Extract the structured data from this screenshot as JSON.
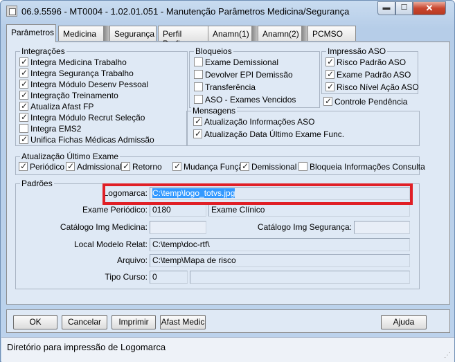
{
  "window": {
    "title": "06.9.5596 - MT0004 - 1.02.01.051 - Manutenção Parâmetros Medicina/Segurança",
    "min_glyph": "▬",
    "max_glyph": "☐",
    "close_glyph": "✕"
  },
  "tabs": [
    {
      "label": "Parâmetros",
      "active": true
    },
    {
      "label": "Medicina"
    },
    {
      "label": "Segurança"
    },
    {
      "label": "Perfil Profis"
    },
    {
      "label": "Anamn(1)"
    },
    {
      "label": "Anamn(2)"
    },
    {
      "label": "PCMSO"
    }
  ],
  "integracoes": {
    "title": "Integrações",
    "items": [
      {
        "label": "Integra Medicina Trabalho",
        "checked": true
      },
      {
        "label": "Integra Segurança Trabalho",
        "checked": true
      },
      {
        "label": "Integra Módulo Desenv Pessoal",
        "checked": true
      },
      {
        "label": "Integração Treinamento",
        "checked": true
      },
      {
        "label": "Atualiza Afast FP",
        "checked": true
      },
      {
        "label": "Integra Módulo Recrut Seleção",
        "checked": true
      },
      {
        "label": "Integra EMS2",
        "checked": false
      },
      {
        "label": "Unifica Fichas Médicas Admissão",
        "checked": true
      }
    ]
  },
  "bloqueios": {
    "title": "Bloqueios",
    "items": [
      {
        "label": "Exame Demissional",
        "checked": false
      },
      {
        "label": "Devolver EPI Demissão",
        "checked": false
      },
      {
        "label": "Transferência",
        "checked": false
      },
      {
        "label": "ASO - Exames Vencidos",
        "checked": false
      }
    ]
  },
  "impressao": {
    "title": "Impressão ASO",
    "items": [
      {
        "label": "Risco Padrão ASO",
        "checked": true
      },
      {
        "label": "Exame Padrão ASO",
        "checked": true
      },
      {
        "label": "Risco Nível Ação ASO",
        "checked": true
      }
    ]
  },
  "controle_pendencia": {
    "label": "Controle Pendência",
    "checked": true
  },
  "mensagens": {
    "title": "Mensagens",
    "items": [
      {
        "label": "Atualização Informações ASO",
        "checked": true
      },
      {
        "label": "Atualização Data Último Exame Func.",
        "checked": true
      }
    ]
  },
  "atualizacao": {
    "title": "Atualização Último Exame",
    "items": [
      {
        "label": "Periódico",
        "checked": true
      },
      {
        "label": "Admissional",
        "checked": true
      },
      {
        "label": "Retorno",
        "checked": true
      },
      {
        "label": "Mudança Função",
        "checked": true
      },
      {
        "label": "Demissional",
        "checked": true
      },
      {
        "label": "Bloqueia Informações Consulta",
        "checked": false
      }
    ]
  },
  "padroes": {
    "title": "Padrões",
    "logomarca_label": "Logomarca:",
    "logomarca_value": "C:\\temp\\logo_totvs.jpg",
    "exame_periodico_label": "Exame Periódico:",
    "exame_periodico_code": "0180",
    "exame_periodico_desc": "Exame Clínico",
    "catalogo_medicina_label": "Catálogo Img Medicina:",
    "catalogo_medicina_value": "",
    "catalogo_seguranca_label": "Catálogo Img Segurança:",
    "catalogo_seguranca_value": "",
    "local_modelo_label": "Local Modelo Relat:",
    "local_modelo_value": "C:\\temp\\doc-rtf\\",
    "arquivo_label": "Arquivo:",
    "arquivo_value": "C:\\temp\\Mapa de risco",
    "tipo_curso_label": "Tipo Curso:",
    "tipo_curso_code": "0",
    "tipo_curso_desc": ""
  },
  "buttons": {
    "ok": "OK",
    "cancelar": "Cancelar",
    "imprimir": "Imprimir",
    "afast": "Afast Medic",
    "ajuda": "Ajuda"
  },
  "status": "Diretório para impressão de Logomarca",
  "colors": {
    "highlight": "#e01f26",
    "selection": "#3399ff"
  }
}
